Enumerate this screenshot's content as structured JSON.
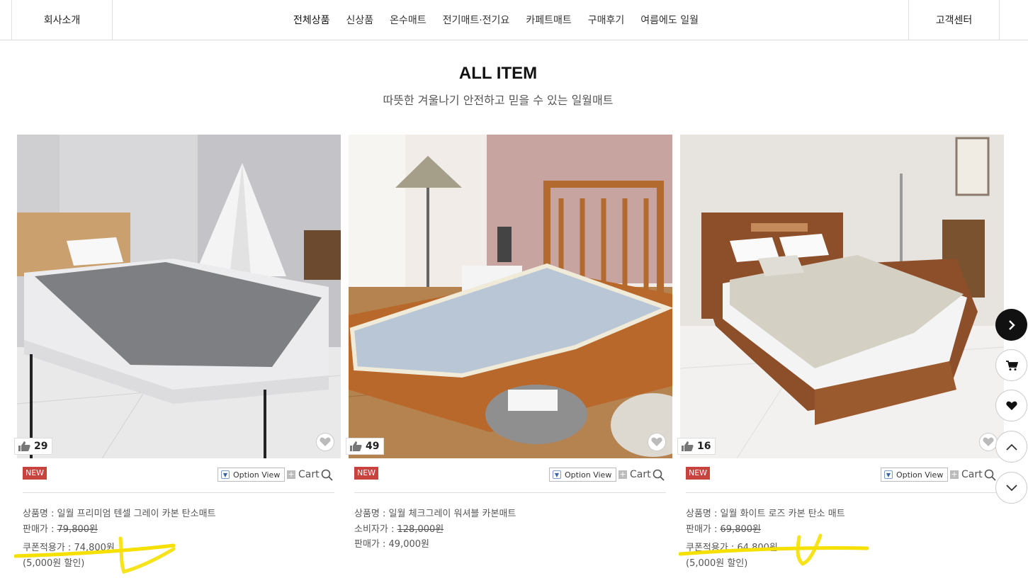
{
  "header": {
    "company_label": "회사소개",
    "support_label": "고객센터",
    "nav": [
      "전체상품",
      "신상품",
      "온수매트",
      "전기매트·전기요",
      "카페트매트",
      "구매후기",
      "여름에도 일월"
    ]
  },
  "section": {
    "title": "ALL ITEM",
    "subtitle": "따뜻한 겨울나기 안전하고 믿을 수 있는 일월매트"
  },
  "products": [
    {
      "likes": "29",
      "badge": "NEW",
      "option_view": "Option View",
      "cart": "Cart",
      "name_row": "상품명 : 일월 프리미엄 텐셀 그레이 카본 탄소매트",
      "price_label": "판매가 : ",
      "price_value": "79,800원",
      "coupon_row": "쿠폰적용가 : 74,800원",
      "discount_row": "(5,000원 할인)",
      "mat_color": "#7d7f83"
    },
    {
      "likes": "49",
      "badge": "NEW",
      "option_view": "Option View",
      "cart": "Cart",
      "name_row": "상품명 : 일월 체크그레이 워셔블 카본매트",
      "consumer_label": "소비자가 : ",
      "consumer_value": "128,000원",
      "sale_row": "판매가 : 49,000원",
      "mat_color": "#b8c6d6"
    },
    {
      "likes": "16",
      "badge": "NEW",
      "option_view": "Option View",
      "cart": "Cart",
      "name_row": "상품명 : 일월 화이트 로즈 카본 탄소 매트",
      "price_label": "판매가 : ",
      "price_value": "69,800원",
      "coupon_row": "쿠폰적용가 : 64,800원",
      "discount_row": "(5,000원 할인)",
      "mat_color": "#d4d0c4"
    }
  ],
  "colors": {
    "badge_red": "#c8433d",
    "highlight_yellow": "#f5e000"
  }
}
